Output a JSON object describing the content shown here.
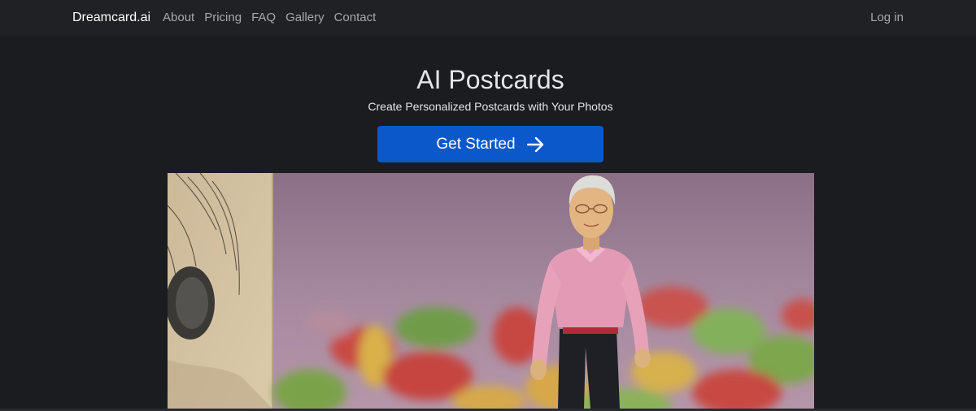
{
  "nav": {
    "brand": "Dreamcard.ai",
    "links": [
      "About",
      "Pricing",
      "FAQ",
      "Gallery",
      "Contact"
    ],
    "login": "Log in"
  },
  "hero": {
    "title": "AI Postcards",
    "subtitle": "Create Personalized Postcards with Your Photos",
    "cta_label": "Get Started",
    "cta_icon": "arrow-right-icon"
  },
  "colors": {
    "page_background": "#1b1c1f",
    "navbar_background": "#202124",
    "primary_button": "#0a58ca",
    "nav_text": "#a7a8ab"
  }
}
